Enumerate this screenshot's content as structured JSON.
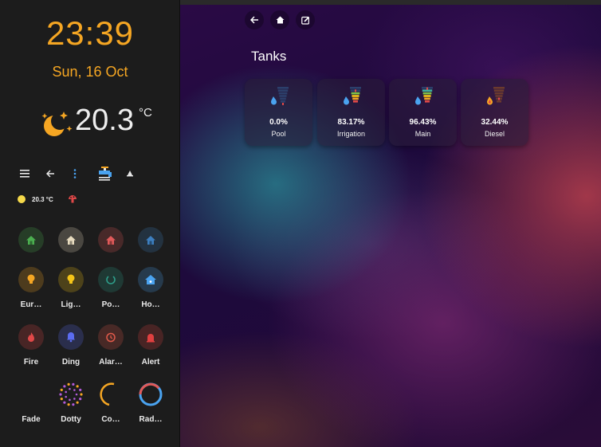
{
  "sidebar": {
    "clock": "23:39",
    "date": "Sun, 16 Oct",
    "weather": {
      "temperature": "20.3",
      "unit": "°C",
      "icon": "partly-cloudy-night-icon"
    },
    "toolbar": [
      "menu-icon",
      "back-arrow-icon",
      "more-vert-icon",
      "water-tap-icon",
      "alarm-bell-icon"
    ],
    "status": {
      "temperature": "20.3 °C"
    },
    "tiles": [
      {
        "label": "",
        "icon": "home-icon",
        "color": "#4caf50"
      },
      {
        "label": "",
        "icon": "home-icon",
        "color": "#e8dcc0"
      },
      {
        "label": "",
        "icon": "home-icon",
        "color": "#e05a5a"
      },
      {
        "label": "",
        "icon": "home-icon",
        "color": "#3d7fbf"
      },
      {
        "label": "Eur…",
        "icon": "lightbulb-icon",
        "color": "#f5a623"
      },
      {
        "label": "Lig…",
        "icon": "lightbulb-icon",
        "color": "#f5c518"
      },
      {
        "label": "Po…",
        "icon": "power-icon",
        "color": "#2e9e8a"
      },
      {
        "label": "Ho…",
        "icon": "home-wifi-icon",
        "color": "#4aa3f0"
      },
      {
        "label": "Fire",
        "icon": "fire-icon",
        "color": "#e04848"
      },
      {
        "label": "Ding",
        "icon": "bell-icon",
        "color": "#5b6cf0"
      },
      {
        "label": "Alar…",
        "icon": "alarm-clock-icon",
        "color": "#e05a4a"
      },
      {
        "label": "Alert",
        "icon": "siren-icon",
        "color": "#e04040"
      },
      {
        "label": "Fade",
        "icon": "",
        "color": ""
      },
      {
        "label": "Dotty",
        "icon": "dots-ring-icon",
        "color": "#b15ad9"
      },
      {
        "label": "Co…",
        "icon": "arc-icon",
        "color": "#f5a623"
      },
      {
        "label": "Rad…",
        "icon": "rainbow-ring-icon",
        "color": "#e05a5a"
      }
    ]
  },
  "main": {
    "nav": [
      "back-arrow-icon",
      "home-icon",
      "edit-icon"
    ],
    "section_title": "Tanks",
    "tanks": [
      {
        "value": "0.0%",
        "name": "Pool",
        "icon": "water-level-icon"
      },
      {
        "value": "83.17%",
        "name": "Irrigation",
        "icon": "water-level-icon"
      },
      {
        "value": "96.43%",
        "name": "Main",
        "icon": "water-level-icon"
      },
      {
        "value": "32.44%",
        "name": "Diesel",
        "icon": "fuel-level-icon"
      }
    ]
  }
}
